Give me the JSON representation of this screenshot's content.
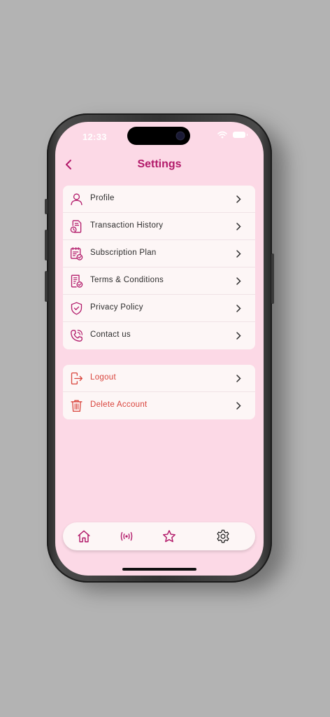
{
  "status_bar": {
    "time": "12:33"
  },
  "header": {
    "title": "Settings"
  },
  "menu": {
    "items": [
      {
        "label": "Profile",
        "icon": "user-icon"
      },
      {
        "label": "Transaction History",
        "icon": "document-clock-icon"
      },
      {
        "label": "Subscription Plan",
        "icon": "calendar-check-icon"
      },
      {
        "label": "Terms & Conditions",
        "icon": "document-check-icon"
      },
      {
        "label": "Privacy Policy",
        "icon": "shield-check-icon"
      },
      {
        "label": "Contact us",
        "icon": "phone-icon"
      }
    ]
  },
  "account": {
    "logout": {
      "label": "Logout",
      "icon": "logout-icon"
    },
    "delete": {
      "label": "Delete Account",
      "icon": "trash-icon"
    }
  },
  "tabbar": {
    "tabs": [
      {
        "name": "home",
        "icon": "home-icon"
      },
      {
        "name": "live",
        "icon": "broadcast-icon"
      },
      {
        "name": "favorites",
        "icon": "star-icon"
      },
      {
        "name": "settings",
        "icon": "gear-icon",
        "active": true
      }
    ]
  },
  "colors": {
    "accent": "#b21a6a",
    "screen_bg": "#fcd9e6",
    "card_bg": "#fdf6f6",
    "danger": "#d9443c",
    "backdrop": "#b3b3b3"
  }
}
